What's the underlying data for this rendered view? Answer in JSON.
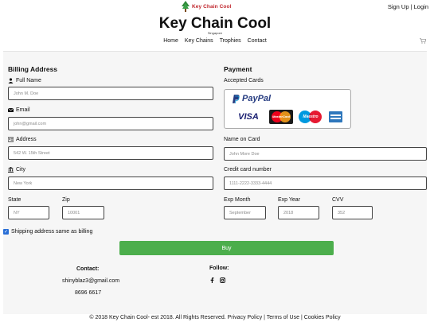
{
  "header": {
    "brand": "Key Chain Cool",
    "auth": {
      "signup": "Sign Up",
      "separator": "|",
      "login": "Login"
    },
    "title": "Key Chain Cool",
    "subtitle": "Singapore",
    "nav": [
      "Home",
      "Key Chains",
      "Trophies",
      "Contact"
    ]
  },
  "billing": {
    "heading": "Billing Address",
    "full_name": {
      "label": "Full Name",
      "placeholder": "John M. Doe"
    },
    "email": {
      "label": "Email",
      "placeholder": "john@gmail.com"
    },
    "address": {
      "label": "Address",
      "placeholder": "542 W. 15th Street"
    },
    "city": {
      "label": "City",
      "placeholder": "New York"
    },
    "state": {
      "label": "State",
      "placeholder": "NY"
    },
    "zip": {
      "label": "Zip",
      "placeholder": "10001"
    }
  },
  "payment": {
    "heading": "Payment",
    "accepted_label": "Accepted Cards",
    "paypal": "PayPal",
    "visa": "VISA",
    "mastercard": "MasterCard",
    "maestro": "Maestro",
    "name_on_card": {
      "label": "Name on Card",
      "placeholder": "John More Doe"
    },
    "card_number": {
      "label": "Credit card number",
      "placeholder": "1111-2222-3333-4444"
    },
    "exp_month": {
      "label": "Exp Month",
      "placeholder": "September"
    },
    "exp_year": {
      "label": "Exp Year",
      "placeholder": "2018"
    },
    "cvv": {
      "label": "CVV",
      "placeholder": "352"
    }
  },
  "shipping_same": {
    "label": "Shipping address same as billing",
    "checked": true
  },
  "buy_label": "Buy",
  "footer": {
    "contact_heading": "Contact:",
    "email": "shinyblaz3@gmail.com",
    "phone": "8696 6617",
    "follow_heading": "Follow:",
    "copyright": "© 2018 Key Chain Cool- est 2018. All Rights Reserved. Privacy Policy | Terms of Use | Cookies Policy"
  },
  "colors": {
    "accent_green": "#4cae4c",
    "brand_red": "#c0262d",
    "checkbox_blue": "#2a6fd6"
  }
}
